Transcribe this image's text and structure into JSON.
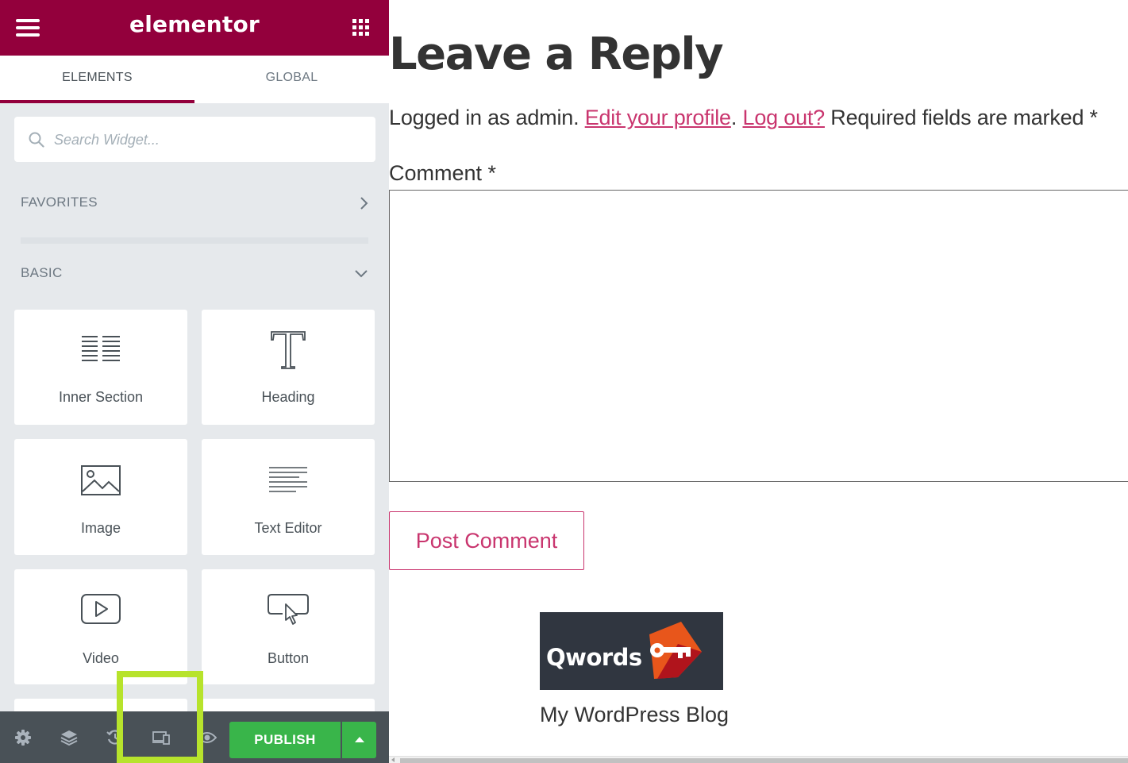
{
  "panel": {
    "logo": "elementor",
    "header_color": "#93003c",
    "tabs": [
      {
        "label": "ELEMENTS",
        "active": true
      },
      {
        "label": "GLOBAL",
        "active": false
      }
    ],
    "search": {
      "placeholder": "Search Widget...",
      "value": ""
    },
    "categories": {
      "favorites": "FAVORITES",
      "basic": "BASIC"
    },
    "widgets": [
      {
        "label": "Inner Section",
        "icon": "inner-section-icon"
      },
      {
        "label": "Heading",
        "icon": "heading-icon"
      },
      {
        "label": "Image",
        "icon": "image-icon"
      },
      {
        "label": "Text Editor",
        "icon": "text-editor-icon"
      },
      {
        "label": "Video",
        "icon": "video-icon"
      },
      {
        "label": "Button",
        "icon": "button-icon"
      }
    ],
    "footer": {
      "icons": [
        "settings-icon",
        "navigator-icon",
        "history-icon",
        "responsive-mode-icon",
        "preview-icon"
      ],
      "publish_label": "PUBLISH",
      "publish_color": "#39b54a",
      "highlight_color": "#b7e32c"
    }
  },
  "preview": {
    "reply_title": "Leave a Reply",
    "logged_in_prefix": "Logged in as admin. ",
    "edit_profile_link": "Edit your profile",
    "separator": ". ",
    "logout_link": "Log out?",
    "required_suffix": " Required fields are marked *",
    "comment_label": "Comment *",
    "comment_value": "",
    "post_comment_label": "Post Comment",
    "link_color": "#c9356e",
    "site_logo_text": "Qwords",
    "site_title": "My WordPress Blog"
  }
}
